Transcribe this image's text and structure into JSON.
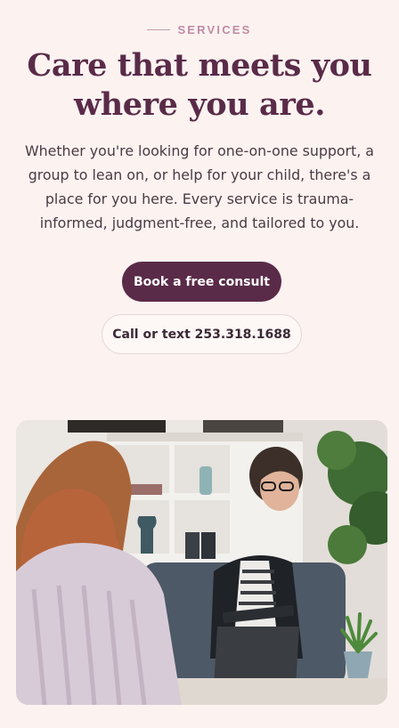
{
  "section": {
    "eyebrow": "SERVICES",
    "headline_line1": "Care that meets you",
    "headline_line2": "where you are.",
    "description": "Whether you're looking for one-on-one support, a group to lean on, or help for your child, there's a place for you here. Every service is trauma-informed, judgment-free, and tailored to you."
  },
  "cta": {
    "primary_label": "Book a free consult",
    "secondary_label": "Call or text 253.318.1688"
  },
  "photo": {
    "subject": "therapy session photo"
  },
  "colors": {
    "background": "#fcf3f1",
    "accent": "#5a2b48",
    "eyebrow": "#c08aa3"
  }
}
